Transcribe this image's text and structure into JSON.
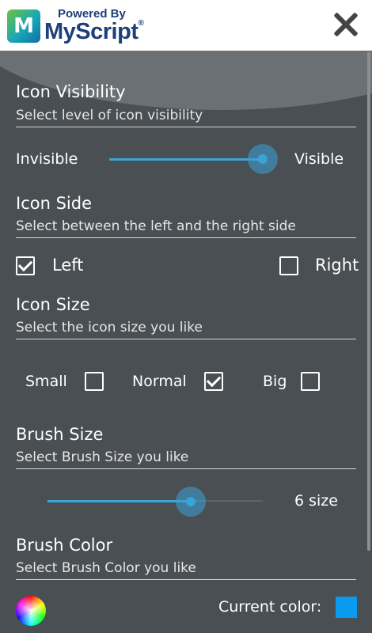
{
  "header": {
    "logo_mark": "M",
    "powered_by": "Powered By",
    "brand": "MyScript",
    "registered": "®"
  },
  "icon_visibility": {
    "title": "Icon Visibility",
    "subtitle": "Select level of icon visibility",
    "min_label": "Invisible",
    "max_label": "Visible",
    "level": 1.0
  },
  "icon_side": {
    "title": "Icon Side",
    "subtitle": "Select between the left and the right side",
    "left_label": "Left",
    "right_label": "Right",
    "selected": "Left"
  },
  "icon_size": {
    "title": "Icon Size",
    "subtitle": "Select the icon size you like",
    "options": [
      {
        "label": "Small",
        "checked": false
      },
      {
        "label": "Normal",
        "checked": true
      },
      {
        "label": "Big",
        "checked": false
      }
    ]
  },
  "brush_size": {
    "title": "Brush Size",
    "subtitle": "Select Brush Size you like",
    "value_label": "6 size",
    "level": 0.67
  },
  "brush_color": {
    "title": "Brush Color",
    "subtitle": "Select Brush Color you like",
    "current_label": "Current color:",
    "current_color": "#0a9af0",
    "picker_icon": "color-wheel-icon"
  },
  "colors": {
    "accent": "#3aa3d8",
    "background": "#4a4f53"
  }
}
